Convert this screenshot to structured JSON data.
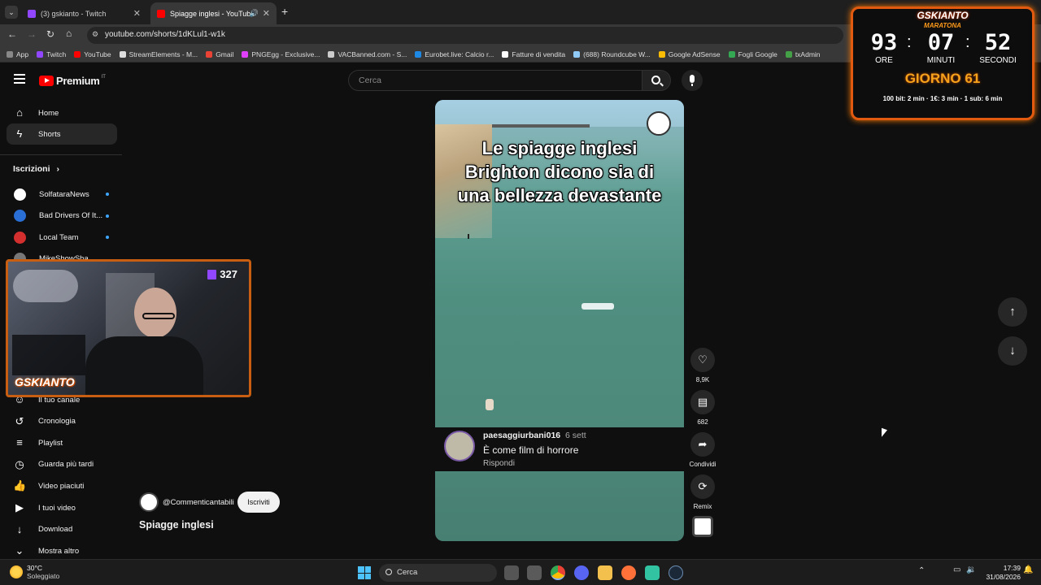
{
  "browser": {
    "tabs": [
      {
        "title": "(3) gskianto - Twitch",
        "favicon_color": "#9146ff"
      },
      {
        "title": "Spiagge inglesi - YouTube",
        "favicon_color": "#ff0000"
      }
    ],
    "new_tab": "+",
    "url": "youtube.com/shorts/1dKLul1-w1k",
    "bookmarks": [
      {
        "label": "App",
        "color": "#888888"
      },
      {
        "label": "Twitch",
        "color": "#9146ff"
      },
      {
        "label": "YouTube",
        "color": "#ff0000"
      },
      {
        "label": "StreamElements - M...",
        "color": "#dddddd"
      },
      {
        "label": "Gmail",
        "color": "#ea4335"
      },
      {
        "label": "PNGEgg - Exclusive...",
        "color": "#e040fb"
      },
      {
        "label": "VACBanned.com - S...",
        "color": "#cccccc"
      },
      {
        "label": "Eurobet.live: Calcio r...",
        "color": "#1e88e5"
      },
      {
        "label": "Fatture di vendita",
        "color": "#ffffff"
      },
      {
        "label": "(688) Roundcube W...",
        "color": "#90caf9"
      },
      {
        "label": "Google AdSense",
        "color": "#fbbc04"
      },
      {
        "label": "Fogli Google",
        "color": "#34a853"
      },
      {
        "label": "txAdmin",
        "color": "#43a047"
      }
    ]
  },
  "youtube": {
    "logo": "Premium",
    "region": "IT",
    "search_placeholder": "Cerca",
    "nav": [
      {
        "label": "Home",
        "icon": "home-icon"
      },
      {
        "label": "Shorts",
        "icon": "shorts-icon"
      }
    ],
    "subs_title": "Iscrizioni",
    "subs_chevron": "›",
    "subscriptions": [
      {
        "name": "SolfataraNews",
        "color": "#ffffff"
      },
      {
        "name": "Bad Drivers Of It...",
        "color": "#2a6fd6"
      },
      {
        "name": "Local Team",
        "color": "#d32f2f"
      },
      {
        "name": "MikeShowSha",
        "color": "#777777"
      }
    ],
    "you_items": [
      {
        "label": "Il tuo canale",
        "icon": "channel-icon"
      },
      {
        "label": "Cronologia",
        "icon": "history-icon"
      },
      {
        "label": "Playlist",
        "icon": "playlist-icon"
      },
      {
        "label": "Guarda più tardi",
        "icon": "watch-later-icon"
      },
      {
        "label": "Video piaciuti",
        "icon": "like-icon"
      },
      {
        "label": "I tuoi video",
        "icon": "video-icon"
      },
      {
        "label": "Download",
        "icon": "download-icon"
      },
      {
        "label": "Mostra altro",
        "icon": "chevron-down-icon"
      }
    ],
    "short": {
      "caption_lines": [
        "Le spiagge inglesi",
        "Brighton dicono sia di",
        "una bellezza devastante"
      ],
      "channel": "@Commenticantabili",
      "subscribe": "Iscriviti",
      "title": "Spiagge inglesi",
      "comment": {
        "user": "paesaggiurbani016",
        "date": "6 sett",
        "text": "È come film di horrore",
        "reply": "Rispondi"
      },
      "actions": [
        {
          "label": "8,9K",
          "icon": "like-icon"
        },
        {
          "label": "682",
          "icon": "comment-icon"
        },
        {
          "label": "Condividi",
          "icon": "share-icon"
        },
        {
          "label": "Remix",
          "icon": "remix-icon"
        }
      ]
    }
  },
  "overlay": {
    "brand": "GSKIANTO",
    "subtitle": "MARATONA",
    "hours": "93",
    "minutes": "07",
    "seconds": "52",
    "hours_label": "ORE",
    "minutes_label": "MINUTI",
    "seconds_label": "SECONDI",
    "day": "GIORNO 61",
    "rates": "100 bit: 2 min · 1€: 3 min · 1 sub: 6 min",
    "viewers": "327",
    "cam_logo": "GSKIANTO"
  },
  "taskbar": {
    "weather_temp": "30°C",
    "weather_desc": "Soleggiato",
    "search": "Cerca",
    "time": "17:39",
    "date": "31/08/2026"
  }
}
